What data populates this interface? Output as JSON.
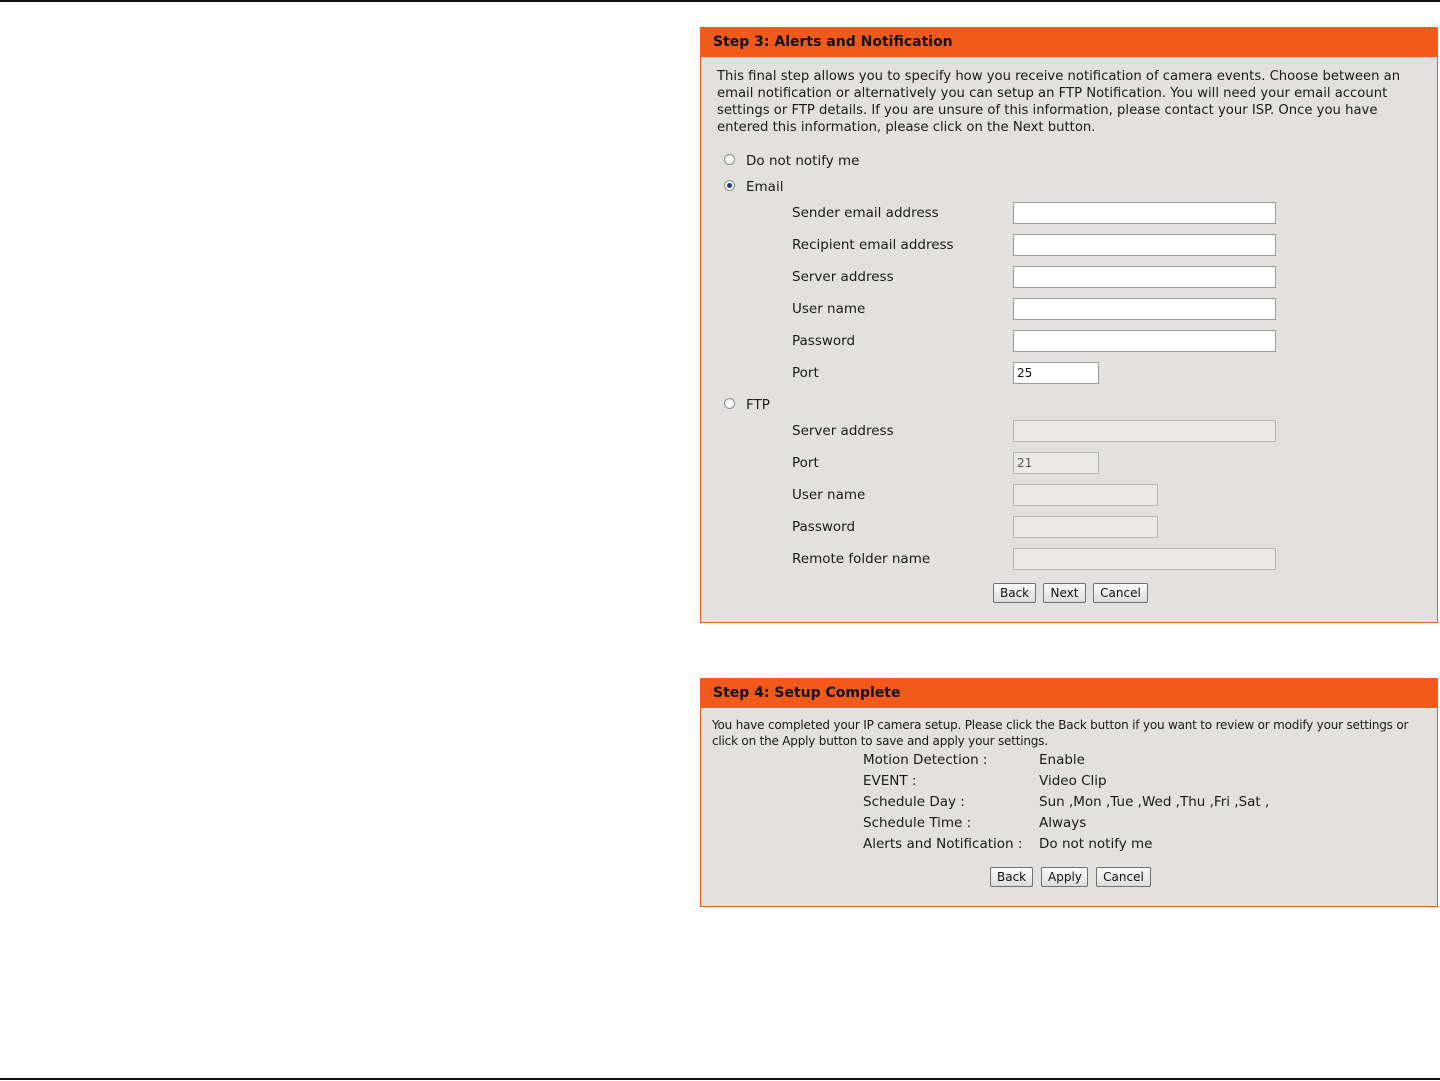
{
  "step3": {
    "title": "Step 3: Alerts and Notification",
    "description": "This final step allows you to specify how you receive notification of camera events. Choose between an email notification or alternatively you can setup an FTP Notification. You will need your email account settings or FTP details. If you are unsure of this information, please contact your ISP. Once you have entered this information, please click on the Next button.",
    "options": {
      "none_label": "Do not notify me",
      "email_label": "Email",
      "ftp_label": "FTP",
      "selected": "email"
    },
    "email": {
      "sender_label": "Sender email address",
      "sender_value": "",
      "recipient_label": "Recipient email address",
      "recipient_value": "",
      "server_label": "Server address",
      "server_value": "",
      "username_label": "User name",
      "username_value": "",
      "password_label": "Password",
      "password_value": "",
      "port_label": "Port",
      "port_value": "25"
    },
    "ftp": {
      "server_label": "Server address",
      "server_value": "",
      "port_label": "Port",
      "port_value": "21",
      "username_label": "User name",
      "username_value": "",
      "password_label": "Password",
      "password_value": "",
      "folder_label": "Remote folder name",
      "folder_value": ""
    },
    "buttons": {
      "back": "Back",
      "next": "Next",
      "cancel": "Cancel"
    }
  },
  "step4": {
    "title": "Step 4: Setup Complete",
    "description": "You have completed your IP camera setup. Please click the Back button if you want to review or modify your settings or click on the Apply button to save and apply your settings.",
    "summary": [
      {
        "key": "Motion Detection :",
        "value": "Enable"
      },
      {
        "key": "EVENT :",
        "value": "Video Clip"
      },
      {
        "key": "Schedule Day :",
        "value": "Sun ,Mon ,Tue ,Wed ,Thu ,Fri ,Sat ,"
      },
      {
        "key": "Schedule Time :",
        "value": "Always"
      },
      {
        "key": "Alerts and Notification :",
        "value": "Do not notify me"
      }
    ],
    "buttons": {
      "back": "Back",
      "apply": "Apply",
      "cancel": "Cancel"
    }
  }
}
